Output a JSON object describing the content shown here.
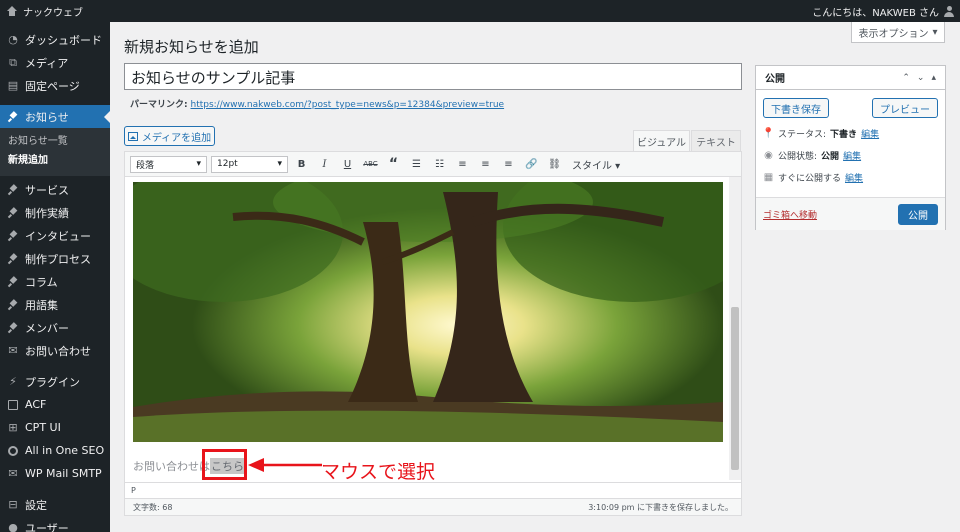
{
  "adminbar": {
    "site_name": "ナックウェブ",
    "greeting": "こんにちは、NAKWEB さん"
  },
  "sidebar": {
    "items": [
      {
        "label": "ダッシュボード",
        "icon": "dashboard-icon"
      },
      {
        "label": "メディア",
        "icon": "media-icon"
      },
      {
        "label": "固定ページ",
        "icon": "page-icon"
      },
      {
        "label": "お知らせ",
        "icon": "pin-icon",
        "active": true
      },
      {
        "label": "サービス",
        "icon": "pin-icon"
      },
      {
        "label": "制作実績",
        "icon": "pin-icon"
      },
      {
        "label": "インタビュー",
        "icon": "pin-icon"
      },
      {
        "label": "制作プロセス",
        "icon": "pin-icon"
      },
      {
        "label": "コラム",
        "icon": "pin-icon"
      },
      {
        "label": "用語集",
        "icon": "pin-icon"
      },
      {
        "label": "メンバー",
        "icon": "pin-icon"
      },
      {
        "label": "お問い合わせ",
        "icon": "mail-icon"
      },
      {
        "label": "プラグイン",
        "icon": "plugin-icon"
      },
      {
        "label": "ACF",
        "icon": "acf-icon"
      },
      {
        "label": "CPT UI",
        "icon": "cpt-icon"
      },
      {
        "label": "All in One SEO",
        "icon": "seo-icon"
      },
      {
        "label": "WP Mail SMTP",
        "icon": "smtp-icon"
      },
      {
        "label": "設定",
        "icon": "settings-icon"
      },
      {
        "label": "ユーザー",
        "icon": "users-icon"
      }
    ],
    "submenu": [
      {
        "label": "お知らせ一覧"
      },
      {
        "label": "新規追加",
        "current": true
      }
    ]
  },
  "header": {
    "screen_options": "表示オプション",
    "page_title": "新規お知らせを追加"
  },
  "post": {
    "title": "お知らせのサンプル記事",
    "permalink_label": "パーマリンク:",
    "permalink_url": "https://www.nakweb.com/?post_type=news&p=12384&preview=true"
  },
  "editor": {
    "add_media": "メディアを追加",
    "tab_visual": "ビジュアル",
    "tab_text": "テキスト",
    "format_select": "段落",
    "size_select": "12pt",
    "style_label": "スタイル",
    "paragraph_text": "お問い合わせは",
    "selected_text": "こちら",
    "path": "P",
    "word_count": "文字数: 68",
    "save_status": "3:10:09 pm に下書きを保存しました。"
  },
  "annotation": {
    "label": "マウスで選択",
    "color": "#e8141b"
  },
  "publish": {
    "title": "公開",
    "save_draft": "下書き保存",
    "preview": "プレビュー",
    "status_label": "ステータス:",
    "status_value": "下書き",
    "visibility_label": "公開状態:",
    "visibility_value": "公開",
    "schedule_label": "すぐに公開する",
    "edit": "編集",
    "trash": "ゴミ箱へ移動",
    "publish_button": "公開"
  },
  "colors": {
    "accent": "#2271b1",
    "sidebar_bg": "#1d2327",
    "danger": "#b32d2e"
  }
}
